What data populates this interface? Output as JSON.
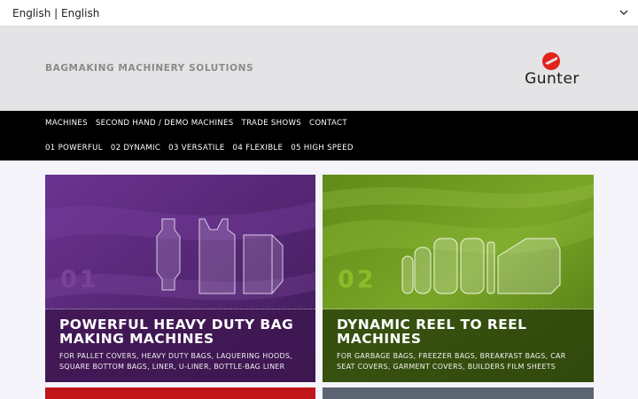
{
  "language": {
    "text": "English | English"
  },
  "header": {
    "tagline": "BAGMAKING MACHINERY SOLUTIONS",
    "logo_text": "Gunter"
  },
  "nav": {
    "row1": [
      "MACHINES",
      "SECOND HAND / DEMO MACHINES",
      "TRADE SHOWS",
      "CONTACT"
    ],
    "row2": [
      "01 POWERFUL",
      "02 DYNAMIC",
      "03 VERSATILE",
      "04 FLEXIBLE",
      "05 HIGH SPEED"
    ]
  },
  "tiles": [
    {
      "number": "01",
      "title": "POWERFUL HEAVY DUTY BAG MAKING MACHINES",
      "subtitle": "FOR PALLET COVERS, HEAVY DUTY BAGS, LAQUERING HOODS, SQUARE BOTTOM BAGS, LINER, U-LINER, BOTTLE-BAG LINER",
      "color": "#5a2a78"
    },
    {
      "number": "02",
      "title": "DYNAMIC REEL TO REEL MACHINES",
      "subtitle": "FOR GARBAGE BAGS, FREEZER BAGS, BREAKFAST BAGS, CAR SEAT COVERS, GARMENT COVERS, BUILDERS FILM SHEETS",
      "color": "#6f9a1c"
    }
  ],
  "colors": {
    "nav_bg": "#000000",
    "header_bg": "#e4e4e6",
    "logo_red": "#e2231a"
  }
}
